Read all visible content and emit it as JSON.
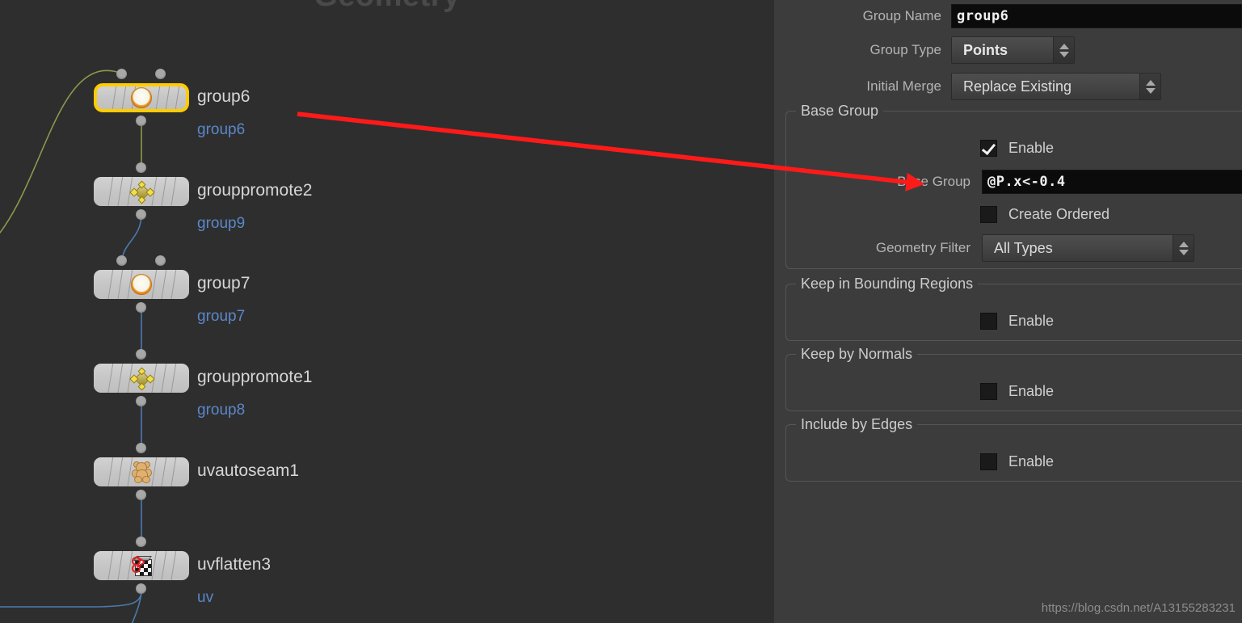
{
  "network": {
    "watermark": "Geometry",
    "nodes": [
      {
        "name": "group6",
        "sublabel": "group6",
        "icon": "group-sphere-icon",
        "selected": true
      },
      {
        "name": "grouppromote2",
        "sublabel": "group9",
        "icon": "group-promote-icon",
        "selected": false
      },
      {
        "name": "group7",
        "sublabel": "group7",
        "icon": "group-sphere-icon",
        "selected": false
      },
      {
        "name": "grouppromote1",
        "sublabel": "group8",
        "icon": "group-promote-icon",
        "selected": false
      },
      {
        "name": "uvautoseam1",
        "sublabel": "",
        "icon": "uv-autoseam-icon",
        "selected": false
      },
      {
        "name": "uvflatten3",
        "sublabel": "uv",
        "icon": "uv-flatten-icon",
        "selected": false
      }
    ],
    "wire_colors": {
      "green": "#8a9a4a",
      "blue": "#4a7ab0"
    }
  },
  "params": {
    "group_name": {
      "label": "Group Name",
      "value": "group6"
    },
    "group_type": {
      "label": "Group Type",
      "value": "Points"
    },
    "initial_merge": {
      "label": "Initial Merge",
      "value": "Replace Existing"
    },
    "base_group": {
      "title": "Base Group",
      "enable": {
        "label": "Enable",
        "checked": true
      },
      "field": {
        "label": "Base Group",
        "value": "@P.x<-0.4"
      },
      "create_ordered": {
        "label": "Create Ordered",
        "checked": false
      },
      "geometry_filter": {
        "label": "Geometry Filter",
        "value": "All Types"
      }
    },
    "keep_in_bounding_regions": {
      "title": "Keep in Bounding Regions",
      "enable": {
        "label": "Enable",
        "checked": false
      }
    },
    "keep_by_normals": {
      "title": "Keep by Normals",
      "enable": {
        "label": "Enable",
        "checked": false
      }
    },
    "include_by_edges": {
      "title": "Include by Edges",
      "enable": {
        "label": "Enable",
        "checked": false
      }
    }
  },
  "annotation": {
    "arrow_color": "#ff1a1a"
  },
  "watermark_url": "https://blog.csdn.net/A13155283231"
}
